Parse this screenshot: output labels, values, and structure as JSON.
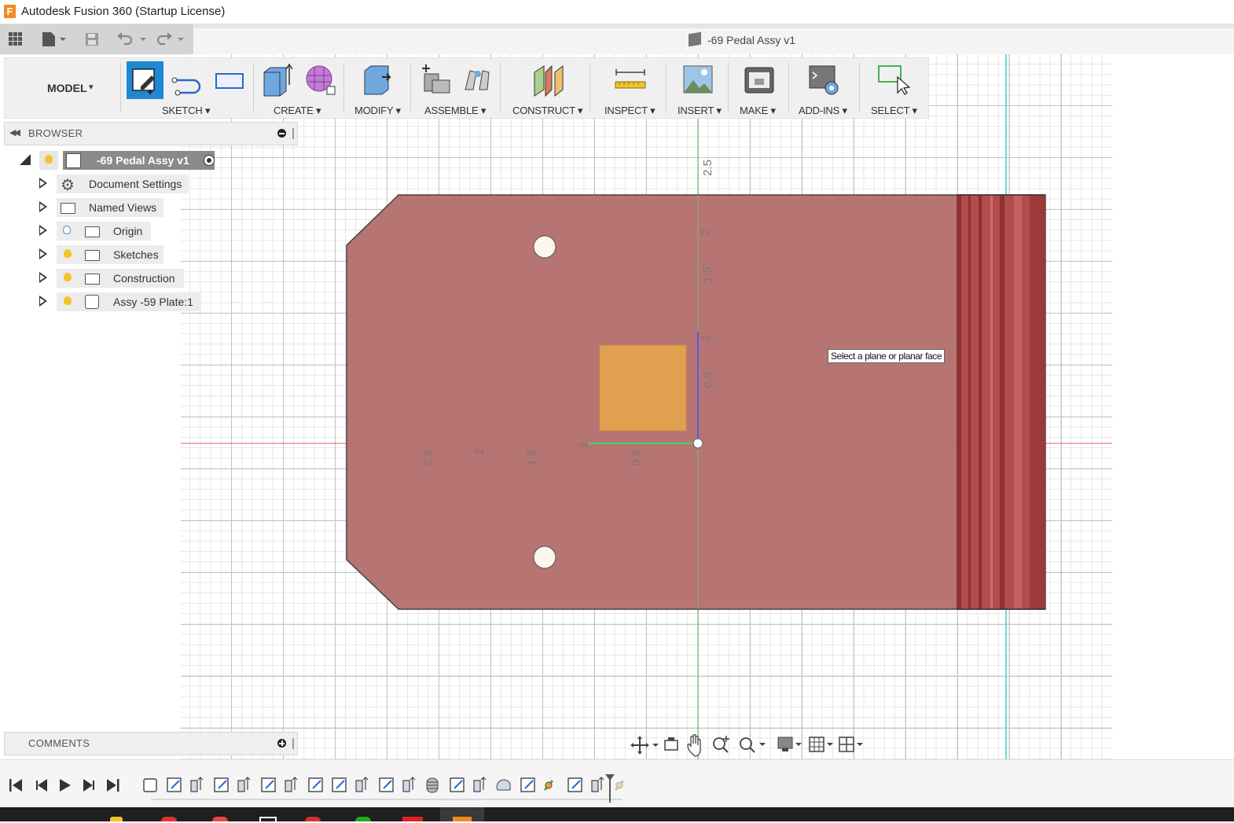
{
  "app": {
    "title": "Autodesk Fusion 360 (Startup License)",
    "logo_letter": "F"
  },
  "document": {
    "title": "-69 Pedal Assy v1"
  },
  "workspace": {
    "label": "MODEL",
    "caret": "▾"
  },
  "toolbar": {
    "groups": [
      {
        "label": "SKETCH ▾"
      },
      {
        "label": "CREATE ▾"
      },
      {
        "label": "MODIFY ▾"
      },
      {
        "label": "ASSEMBLE ▾"
      },
      {
        "label": "CONSTRUCT ▾"
      },
      {
        "label": "INSPECT ▾"
      },
      {
        "label": "INSERT ▾"
      },
      {
        "label": "MAKE ▾"
      },
      {
        "label": "ADD-INS ▾"
      },
      {
        "label": "SELECT ▾"
      }
    ]
  },
  "browser": {
    "title": "BROWSER",
    "root": "-69 Pedal Assy v1",
    "items": [
      {
        "label": "Document Settings"
      },
      {
        "label": "Named Views"
      },
      {
        "label": "Origin"
      },
      {
        "label": "Sketches"
      },
      {
        "label": "Construction"
      },
      {
        "label": "Assy -59 Plate:1"
      }
    ]
  },
  "comments": {
    "title": "COMMENTS"
  },
  "viewport": {
    "tooltip": "Select a plane or planar face",
    "axis_labels_vertical": [
      "2.5",
      "2",
      "1.5",
      "1",
      "0.5"
    ],
    "axis_labels_horizontal": [
      "2.5",
      "2",
      "1.5",
      "1",
      "0.5"
    ],
    "body_color": "#b67473",
    "profile_color": "#e0a050"
  },
  "colors": {
    "accent": "#1e88d2",
    "x_axis": "#e06060",
    "y_axis": "#60c060",
    "z_axis": "#5a5ae0"
  }
}
